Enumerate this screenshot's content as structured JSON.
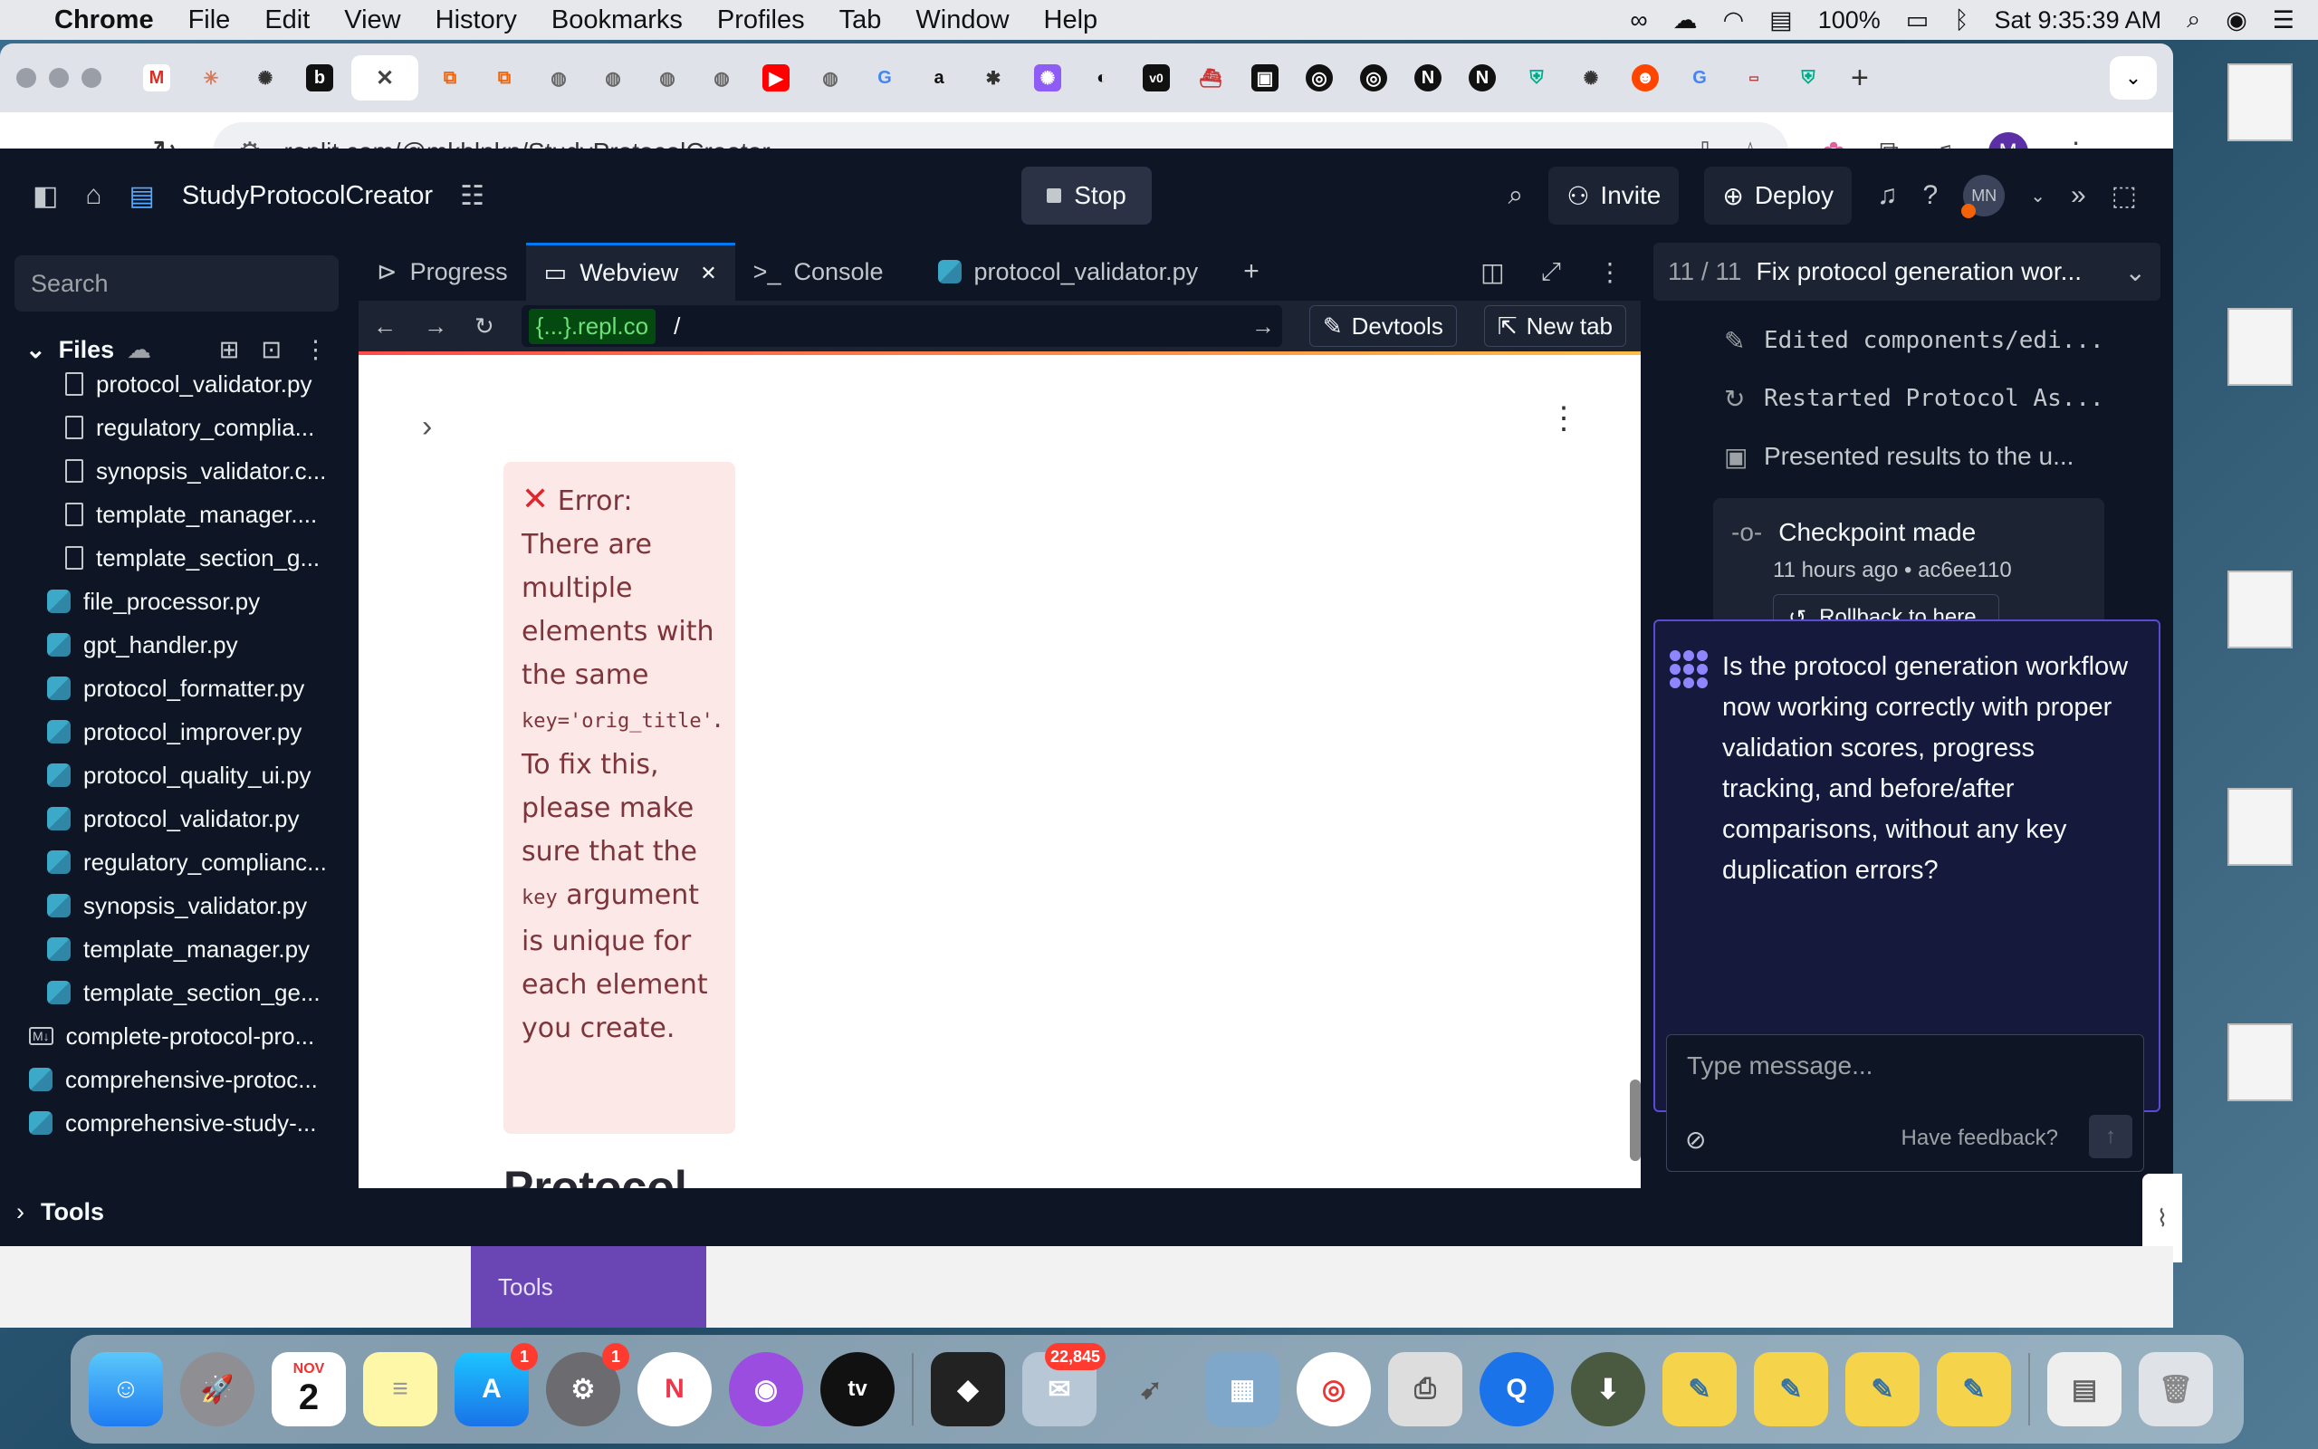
{
  "menubar": {
    "app": "Chrome",
    "items": [
      "File",
      "Edit",
      "View",
      "History",
      "Bookmarks",
      "Profiles",
      "Tab",
      "Window",
      "Help"
    ],
    "battery": "100%",
    "clock": "Sat 9:35:39 AM"
  },
  "browser": {
    "url": "replit.com/@mkhlnkn/StudyProtocolCreator",
    "profile_initial": "M"
  },
  "replit": {
    "project_name": "StudyProtocolCreator",
    "stop_label": "Stop",
    "invite_label": "Invite",
    "deploy_label": "Deploy",
    "user_initials": "MN",
    "sidebar": {
      "search_placeholder": "Search",
      "files_label": "Files",
      "tools_label": "Tools",
      "files": [
        {
          "name": "protocol_validator.py",
          "kind": "doc",
          "level": 2
        },
        {
          "name": "regulatory_complia...",
          "kind": "doc",
          "level": 2
        },
        {
          "name": "synopsis_validator.c...",
          "kind": "doc",
          "level": 2
        },
        {
          "name": "template_manager....",
          "kind": "doc",
          "level": 2
        },
        {
          "name": "template_section_g...",
          "kind": "doc",
          "level": 2
        },
        {
          "name": "file_processor.py",
          "kind": "py",
          "level": 1
        },
        {
          "name": "gpt_handler.py",
          "kind": "py",
          "level": 1
        },
        {
          "name": "protocol_formatter.py",
          "kind": "py",
          "level": 1
        },
        {
          "name": "protocol_improver.py",
          "kind": "py",
          "level": 1
        },
        {
          "name": "protocol_quality_ui.py",
          "kind": "py",
          "level": 1
        },
        {
          "name": "protocol_validator.py",
          "kind": "py",
          "level": 1
        },
        {
          "name": "regulatory_complianc...",
          "kind": "py",
          "level": 1
        },
        {
          "name": "synopsis_validator.py",
          "kind": "py",
          "level": 1
        },
        {
          "name": "template_manager.py",
          "kind": "py",
          "level": 1
        },
        {
          "name": "template_section_ge...",
          "kind": "py",
          "level": 1
        },
        {
          "name": "complete-protocol-pro...",
          "kind": "md",
          "level": 0
        },
        {
          "name": "comprehensive-protoc...",
          "kind": "py",
          "level": 0
        },
        {
          "name": "comprehensive-study-...",
          "kind": "py",
          "level": 0
        }
      ]
    },
    "tabs": [
      {
        "label": "Progress",
        "active": false
      },
      {
        "label": "Webview",
        "active": true
      },
      {
        "label": "Console",
        "active": false
      },
      {
        "label": "protocol_validator.py",
        "active": false
      }
    ],
    "webview": {
      "url_chip": "{...}.repl.co",
      "path": "/",
      "devtools_label": "Devtools",
      "newtab_label": "New tab",
      "error_title": "Error:",
      "error_part1": "There are multiple elements with the same",
      "error_code1": "key='orig_title'",
      "error_part2": ". To fix this, please make sure that the",
      "error_code2": "key",
      "error_part3": "argument is unique for each element you create.",
      "heading": "Protocol"
    },
    "agent": {
      "progress": "11 / 11",
      "task_title": "Fix protocol generation wor...",
      "actions": [
        {
          "icon": "edit-icon",
          "text": "Edited components/edi..."
        },
        {
          "icon": "restart-icon",
          "text": "Restarted Protocol As..."
        },
        {
          "icon": "present-icon",
          "text": "Presented results to the u..."
        }
      ],
      "checkpoint_title": "Checkpoint made",
      "checkpoint_time": "11 hours ago",
      "checkpoint_hash": "ac6ee110",
      "rollback_label": "Rollback to here",
      "question": "Is the protocol generation workflow now working correctly with proper validation scores, progress tracking, and before/after comparisons, without any key duplication errors?",
      "message_placeholder": "Type message...",
      "feedback_label": "Have feedback?"
    }
  },
  "background": {
    "tools_label": "Tools"
  },
  "dock": {
    "calendar_month": "NOV",
    "calendar_day": "2",
    "appstore_badge": "1",
    "settings_badge": "1",
    "mail_badge": "22,845"
  }
}
